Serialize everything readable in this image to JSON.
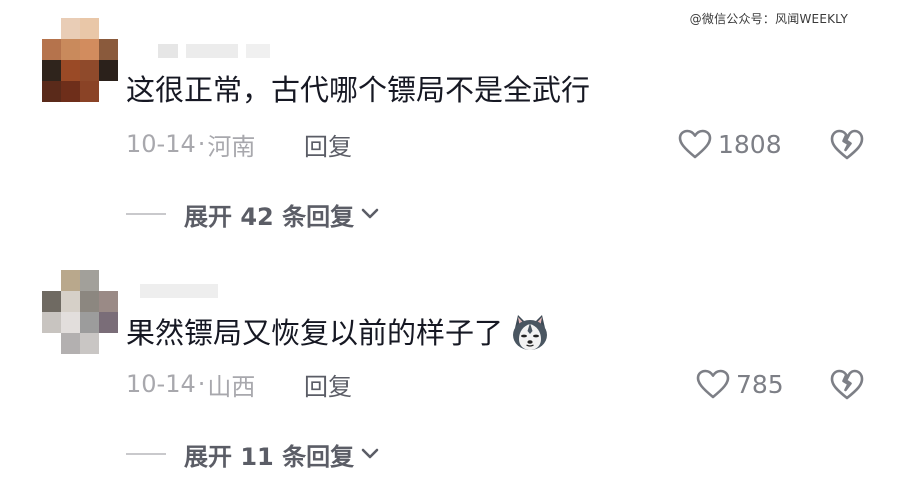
{
  "watermark": "@微信公众号：风闻WEEKLY",
  "comments": [
    {
      "text": "这很正常，古代哪个镖局不是全武行",
      "date": "10-14",
      "separator": "·",
      "region": "河南",
      "reply_label": "回复",
      "likes": "1808",
      "expand_label": "展开 42 条回复",
      "emoji": ""
    },
    {
      "text": "果然镖局又恢复以前的样子了",
      "date": "10-14",
      "separator": "·",
      "region": "山西",
      "reply_label": "回复",
      "likes": "785",
      "expand_label": "展开 11 条回复",
      "emoji": "husky-face"
    }
  ],
  "icons": {
    "like": "heart-outline-icon",
    "dislike": "broken-heart-icon",
    "expand": "chevron-down-icon"
  },
  "colors": {
    "text": "#161823",
    "meta": "#a8a8ad",
    "action": "#5b5d66"
  }
}
